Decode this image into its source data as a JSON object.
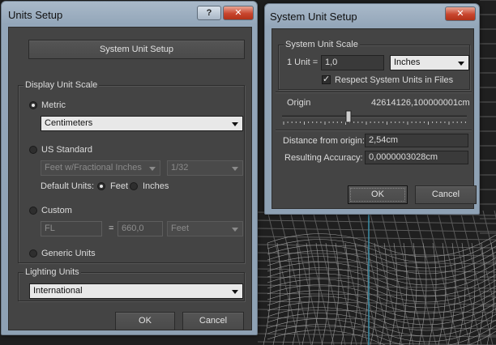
{
  "colors": {
    "window_frame": "#93a6b9",
    "client_bg": "#444444",
    "close_button": "#c8452d"
  },
  "units_setup": {
    "title": "Units Setup",
    "help_label": "?",
    "close_label": "✕",
    "system_unit_setup_button": "System Unit Setup",
    "display_unit_scale": {
      "label": "Display Unit Scale",
      "metric": {
        "label": "Metric",
        "selected": true,
        "dropdown": "Centimeters"
      },
      "us_standard": {
        "label": "US Standard",
        "selected": false,
        "dropdown": "Feet w/Fractional Inches",
        "fraction": "1/32",
        "default_units_label": "Default Units:",
        "feet_label": "Feet",
        "inches_label": "Inches",
        "feet_selected": true
      },
      "custom": {
        "label": "Custom",
        "selected": false,
        "name": "FL",
        "equals": "=",
        "value": "660,0",
        "unit": "Feet"
      },
      "generic": {
        "label": "Generic Units",
        "selected": false
      }
    },
    "lighting_units": {
      "label": "Lighting Units",
      "dropdown": "International"
    },
    "ok_label": "OK",
    "cancel_label": "Cancel"
  },
  "system_unit_setup": {
    "title": "System Unit Setup",
    "close_label": "✕",
    "system_unit_scale": {
      "label": "System Unit Scale",
      "unit_label": "1 Unit =",
      "unit_value": "1,0",
      "unit_dropdown": "Inches",
      "respect_label": "Respect System Units in Files",
      "respect_checked": true
    },
    "origin": {
      "label": "Origin",
      "value": "42614126,100000001cm"
    },
    "distance_label": "Distance from origin:",
    "distance_value": "2,54cm",
    "accuracy_label": "Resulting Accuracy:",
    "accuracy_value": "0,0000003028cm",
    "ok_label": "OK",
    "cancel_label": "Cancel"
  }
}
